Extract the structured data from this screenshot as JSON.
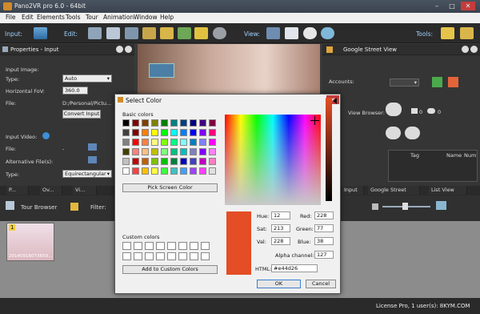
{
  "window": {
    "title": "Pano2VR pro 6.0 - 64bit"
  },
  "menu": [
    "File",
    "Edit",
    "Elements",
    "Tools",
    "Tour",
    "Animation",
    "Window",
    "Help"
  ],
  "toolbar": {
    "input_label": "Input:",
    "edit_label": "Edit:",
    "view_label": "View:",
    "tools_label": "Tools:"
  },
  "properties": {
    "title": "Properties - Input",
    "input_image_heading": "Input Image:",
    "type_label": "Type:",
    "type_value": "Auto",
    "hfov_label": "Horizontal FoV:",
    "hfov_value": "360.0",
    "file_label": "File:",
    "file_value": "D:/Personal/Pictu...",
    "convert_button": "Convert Input",
    "input_video_heading": "Input Video:",
    "video_file_label": "File:",
    "video_file_value": "-",
    "alt_files_label": "Alternative File(s):",
    "video_type_label": "Type:",
    "video_type_value": "Equirectangular"
  },
  "street_view": {
    "title": "Google Street View",
    "accounts_label": "Accounts:",
    "view_browser_label": "View Browser:",
    "count_pics": "0",
    "count_views": "0",
    "table_headers": [
      "Tag",
      "Name",
      "Num"
    ]
  },
  "bottom_tabs_left": [
    "P...",
    "Ov...",
    "Vi..."
  ],
  "bottom_tabs_right": [
    "Input",
    "Google Street View",
    "List View"
  ],
  "tour_browser": {
    "title": "Tour Browser",
    "filter_label": "Filter:",
    "item_label": "1",
    "thumb_caption": "20140916073659..."
  },
  "status": {
    "text": "License Pro, 1 user(s): 8KYM.COM"
  },
  "dialog": {
    "title": "Select Color",
    "basic_colors_label": "Basic colors",
    "pick_screen_button": "Pick Screen Color",
    "custom_colors_label": "Custom colors",
    "add_custom_button": "Add to Custom Colors",
    "hue_label": "Hue:",
    "hue_value": "12",
    "sat_label": "Sat:",
    "sat_value": "213",
    "val_label": "Val:",
    "val_value": "228",
    "red_label": "Red:",
    "red_value": "228",
    "green_label": "Green:",
    "green_value": "77",
    "blue_label": "Blue:",
    "blue_value": "38",
    "alpha_label": "Alpha channel:",
    "alpha_value": "127",
    "html_label": "HTML:",
    "html_value": "#e44d26",
    "ok_button": "OK",
    "cancel_button": "Cancel",
    "current_color": "#e44d26",
    "basic_colors": [
      "#000000",
      "#800000",
      "#804000",
      "#808000",
      "#008000",
      "#008080",
      "#004080",
      "#000080",
      "#400080",
      "#800040",
      "#404040",
      "#800000",
      "#ff8000",
      "#ffff00",
      "#00ff00",
      "#00ffff",
      "#0080ff",
      "#0000ff",
      "#8000ff",
      "#ff0080",
      "#808080",
      "#ff0000",
      "#ff8040",
      "#ffff80",
      "#80ff00",
      "#00ff80",
      "#80ffff",
      "#0080c0",
      "#8080ff",
      "#ff00ff",
      "#404000",
      "#ff8080",
      "#ffc080",
      "#c0c000",
      "#80ff80",
      "#00c080",
      "#00c0c0",
      "#8080c0",
      "#8000ff",
      "#ff80ff",
      "#c0c0c0",
      "#c00000",
      "#c06000",
      "#80c000",
      "#00c000",
      "#008040",
      "#0000c0",
      "#4040c0",
      "#c000c0",
      "#ff80c0",
      "#ffffff",
      "#ff4040",
      "#ffc000",
      "#ffff40",
      "#40ff40",
      "#40c0c0",
      "#40a0ff",
      "#a040ff",
      "#ff40ff",
      "#e0e0e0"
    ]
  }
}
